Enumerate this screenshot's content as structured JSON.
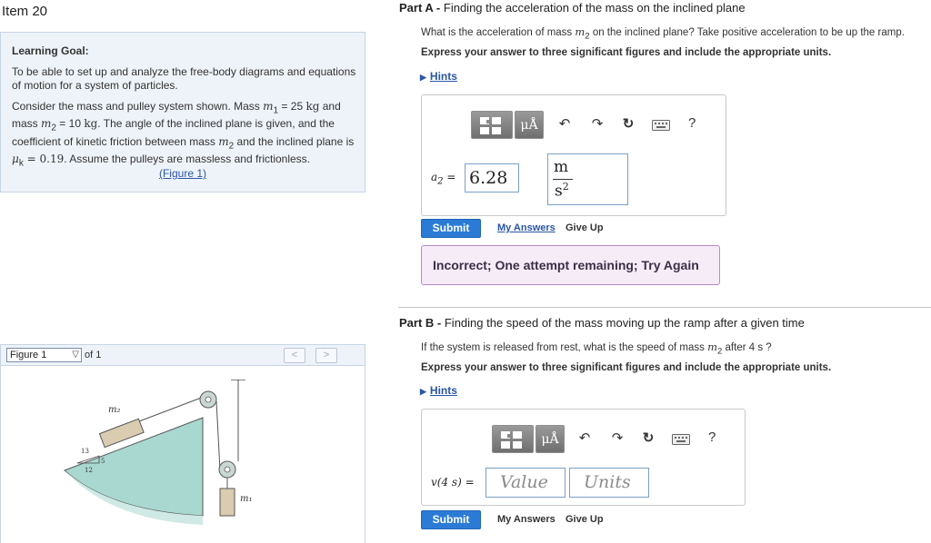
{
  "item_title": "Item 20",
  "learning_goal": {
    "heading": "Learning Goal:",
    "text": "To be able to set up and analyze the free-body diagrams and equations of motion for a system of particles."
  },
  "problem": {
    "intro": "Consider the mass and pulley system shown. Mass",
    "m1_sym": "m",
    "m1_sub": "1",
    "m1_eq": " = 25 ",
    "m1_unit": "kg",
    "and_mass": " and mass ",
    "m2_sym": "m",
    "m2_sub": "2",
    "m2_eq": " = 10 ",
    "m2_unit": "kg",
    "rest": ". The angle of the inclined plane is given, and the coefficient of kinetic friction between mass ",
    "m2b_sym": "m",
    "m2b_sub": "2",
    "rest2": " and the inclined plane is ",
    "mu_sym": "μ",
    "mu_sub": "k",
    "mu_val": " = 0.19",
    "rest3": ". Assume the pulleys are massless and frictionless.",
    "figure_link": "(Figure 1)"
  },
  "figure": {
    "select_value": "Figure 1",
    "of_label": "of 1",
    "prev": "<",
    "next": ">",
    "labels": {
      "m2": "m₂",
      "m1": "m₁",
      "hyp": "13",
      "opp": "5",
      "adj": "12"
    }
  },
  "part_a": {
    "label": "Part A -",
    "title": "Finding the acceleration of the mass on the inclined plane",
    "question_pre": "What is the acceleration of mass ",
    "question_sym": "m",
    "question_sub": "2",
    "question_post": " on the inclined plane? Take positive acceleration to be up the ramp.",
    "instructions": "Express your answer to three significant figures and include the appropriate units.",
    "hints": "Hints",
    "var_sym": "a",
    "var_sub": "2",
    "var_eq": " =",
    "value": "6.28",
    "unit_num": "m",
    "unit_den": "s",
    "unit_exp": "2",
    "submit": "Submit",
    "my_answers": "My Answers",
    "give_up": "Give Up",
    "feedback": "Incorrect; One attempt remaining; Try Again"
  },
  "part_b": {
    "label": "Part B -",
    "title": "Finding the speed of the mass moving up the ramp after a given time",
    "question_pre": "If the system is released from rest, what is the speed of mass ",
    "question_sym": "m",
    "question_sub": "2",
    "question_post": " after 4  s ?",
    "instructions": "Express your answer to three significant figures and include the appropriate units.",
    "hints": "Hints",
    "var_label": "v(4 s) =",
    "value_placeholder": "Value",
    "units_placeholder": "Units",
    "submit": "Submit",
    "my_answers": "My Answers",
    "give_up": "Give Up"
  },
  "toolbar": {
    "templates_icon": "templates-icon",
    "units_label": "μÅ",
    "undo": "↶",
    "redo": "↷",
    "reset": "↻",
    "keyboard_icon": "keyboard-icon",
    "help": "?"
  },
  "colors": {
    "accent": "#2b7bd6",
    "link": "#2a55a6",
    "panel_bg": "#eef3f9",
    "feedback_bg": "#f6ecf8",
    "incline_fill": "#a9d8d0"
  }
}
